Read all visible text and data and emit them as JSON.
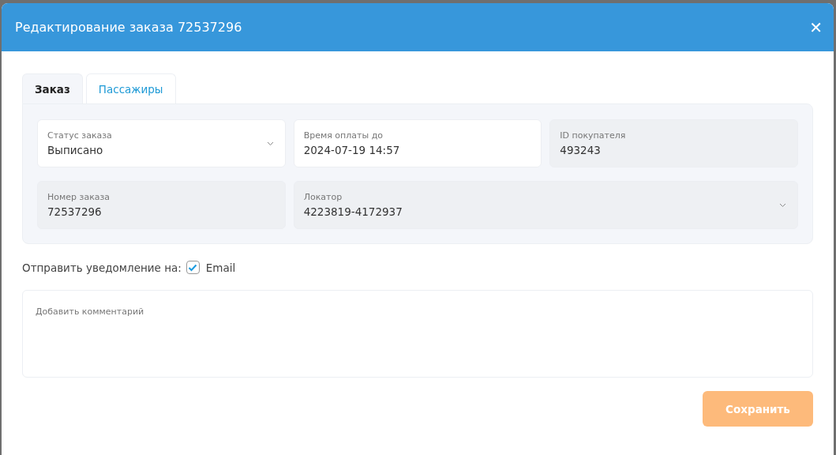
{
  "window": {
    "title": "Редактирование заказа 72537296",
    "close": "✕"
  },
  "tabs": [
    {
      "label": "Заказ",
      "selected": true
    },
    {
      "label": "Пассажиры",
      "selected": false
    }
  ],
  "fields": [
    {
      "label": "Статус заказа",
      "value": "Выписано",
      "kind": "select",
      "readonly": false
    },
    {
      "label": "Время оплаты до",
      "value": "2024-07-19 14:57",
      "kind": "text",
      "readonly": false
    },
    {
      "label": "ID покупателя",
      "value": "493243",
      "kind": "text",
      "readonly": true
    },
    {
      "label": "Номер заказа",
      "value": "72537296",
      "kind": "text",
      "readonly": true
    },
    {
      "label": "Локатор",
      "value": "4223819-4172937",
      "kind": "select",
      "readonly": true
    }
  ],
  "notify": {
    "label": "Отправить уведомление на:",
    "options": [
      {
        "label": "Email",
        "checked": true
      }
    ]
  },
  "comment": {
    "placeholder": "Добавить комментарий"
  },
  "buttons": [
    {
      "label": "Сохранить"
    }
  ]
}
